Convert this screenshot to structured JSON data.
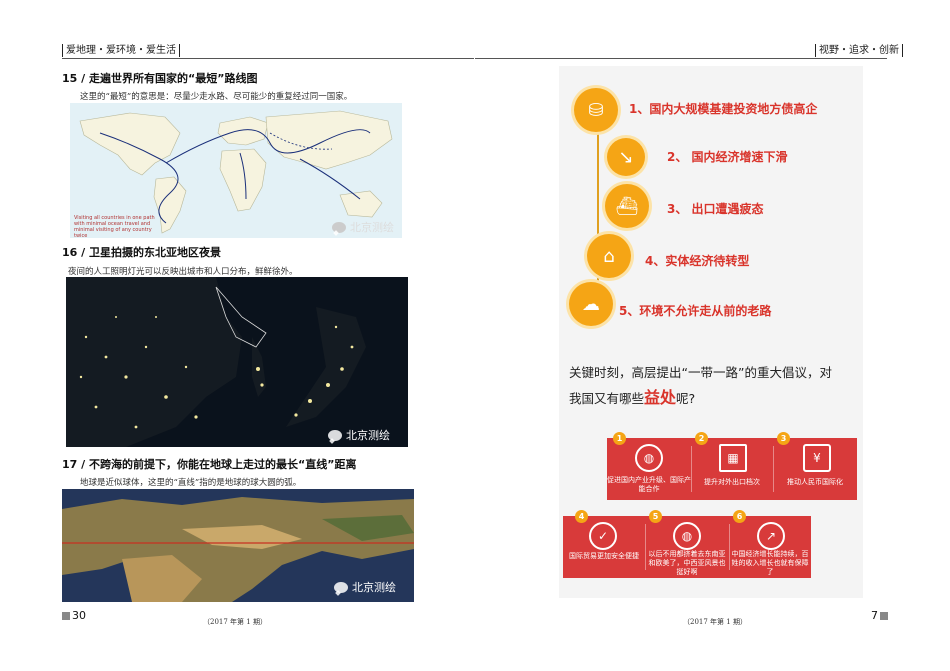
{
  "left_page": {
    "header": "爱地理・爱环境・爱生活",
    "sections": [
      {
        "title": "15 / 走遍世界所有国家的“最短”路线图",
        "desc": "这里的“最短”的意思是：尽量少走水路、尽可能少的重复经过同一国家。",
        "map_caption": "Visiting all countries in one path with minimal ocean travel and minimal visiting of any country twice",
        "watermark": "北京测绘"
      },
      {
        "title": "16 / 卫星拍摄的东北亚地区夜景",
        "desc": "夜间的人工照明灯光可以反映出城市和人口分布，鲜鲜徐外。",
        "watermark": "北京测绘"
      },
      {
        "title": "17 / 不跨海的前提下，你能在地球上走过的最长“直线”距离",
        "desc": "地球是近似球体，这里的“直线”指的是地球的球大圆的弧。",
        "watermark": "北京测绘"
      }
    ],
    "page_number": "30",
    "issue": "（2017 年第 1 期）"
  },
  "right_page": {
    "header": "视野・追求・创新",
    "steps": [
      {
        "label": "1、国内大规模基建投资地方债高企",
        "icon": "stack-coins-icon"
      },
      {
        "label": "2、 国内经济增速下滑",
        "icon": "chart-down-icon"
      },
      {
        "label": "3、 出口遭遇疲态",
        "icon": "cargo-ship-icon"
      },
      {
        "label": "4、实体经济待转型",
        "icon": "factory-icon"
      },
      {
        "label": "5、环境不允许走从前的老路",
        "icon": "smog-icon"
      }
    ],
    "question_part1": "关键时刻，高层提出“一带一路”的重大倡议，对",
    "question_part2": "我国又有哪些",
    "question_highlight": "益处",
    "question_part3": "呢?",
    "benefits_row1": [
      {
        "num": "1",
        "label": "促进国内产业升级、国际产能合作"
      },
      {
        "num": "2",
        "label": "提升对外出口档次"
      },
      {
        "num": "3",
        "label": "推动人民币国际化"
      }
    ],
    "benefits_row2": [
      {
        "num": "4",
        "label": "国际贸易更加安全便捷"
      },
      {
        "num": "5",
        "label": "以后不用都挤着去东南亚和欧美了，中西亚风景也挺好啊"
      },
      {
        "num": "6",
        "label": "中国经济增长能持续，百姓的收入增长也就有保障了"
      }
    ],
    "page_number": "7",
    "issue": "（2017 年第 1 期）"
  },
  "colors": {
    "accent_red": "#d83a3a",
    "accent_orange": "#f5a515"
  }
}
